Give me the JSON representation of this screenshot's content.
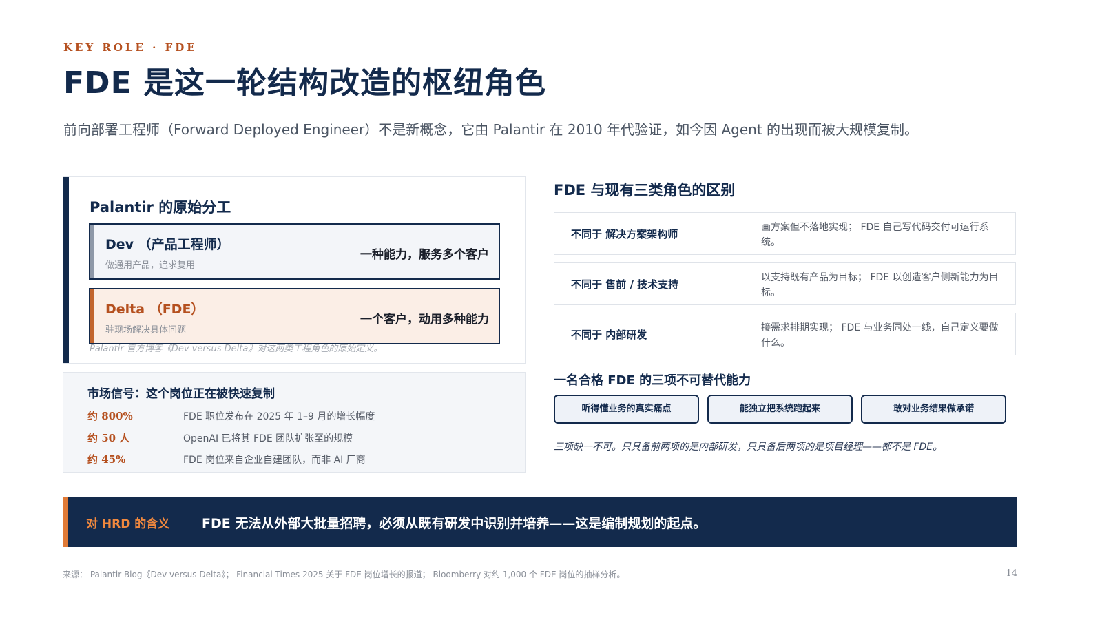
{
  "header": {
    "kicker": "KEY ROLE · FDE",
    "title": "FDE 是这一轮结构改造的枢纽角色",
    "subtitle": "前向部署工程师（Forward Deployed Engineer）不是新概念，它由 Palantir 在 2010 年代验证，如今因 Agent 的出现而被大规模复制。"
  },
  "palantir_card": {
    "title": "Palantir 的原始分工",
    "roles": [
      {
        "name": "Dev （产品工程师）",
        "desc": "做通用产品，追求复用",
        "tag": "一种能力，服务多个客户"
      },
      {
        "name": "Delta （FDE）",
        "desc": "驻现场解决具体问题",
        "tag": "一个客户，动用多种能力"
      }
    ],
    "caption": "Palantir 官方博客《Dev versus Delta》对这两类工程角色的原始定义。"
  },
  "market_signal": {
    "title": "市场信号：这个岗位正在被快速复制",
    "rows": [
      {
        "value": "约 800%",
        "text": "FDE 职位发布在 2025 年 1–9 月的增长幅度"
      },
      {
        "value": "约 50 人",
        "text": "OpenAI 已将其 FDE 团队扩张至的规模"
      },
      {
        "value": "约 45%",
        "text": "FDE 岗位来自企业自建团队，而非 AI 厂商"
      }
    ]
  },
  "differences": {
    "title": "FDE 与现有三类角色的区别",
    "rows": [
      {
        "label": "不同于 解决方案架构师",
        "text": "画方案但不落地实现； FDE 自己写代码交付可运行系统。"
      },
      {
        "label": "不同于 售前 / 技术支持",
        "text": "以支持既有产品为目标； FDE 以创造客户侧新能力为目标。"
      },
      {
        "label": "不同于 内部研发",
        "text": "接需求排期实现； FDE 与业务同处一线，自己定义要做什么。"
      }
    ]
  },
  "abilities": {
    "title": "一名合格 FDE 的三项不可替代能力",
    "items": [
      "听得懂业务的真实痛点",
      "能独立把系统跑起来",
      "敢对业务结果做承诺"
    ],
    "note": "三项缺一不可。只具备前两项的是内部研发，只具备后两项的是项目经理——都不是 FDE。"
  },
  "banner": {
    "label": "对 HRD 的含义",
    "message": "FDE 无法从外部大批量招聘，必须从既有研发中识别并培养——这是编制规划的起点。"
  },
  "footer": {
    "source": "来源： Palantir Blog《Dev versus Delta》； Financial Times 2025 关于 FDE 岗位增长的报道； Bloomberry 对约 1,000 个 FDE 岗位的抽样分析。",
    "page": "14"
  },
  "colors": {
    "navy": "#132a4c",
    "accent_orange": "#b5501f",
    "banner_accent": "#e07a36"
  }
}
